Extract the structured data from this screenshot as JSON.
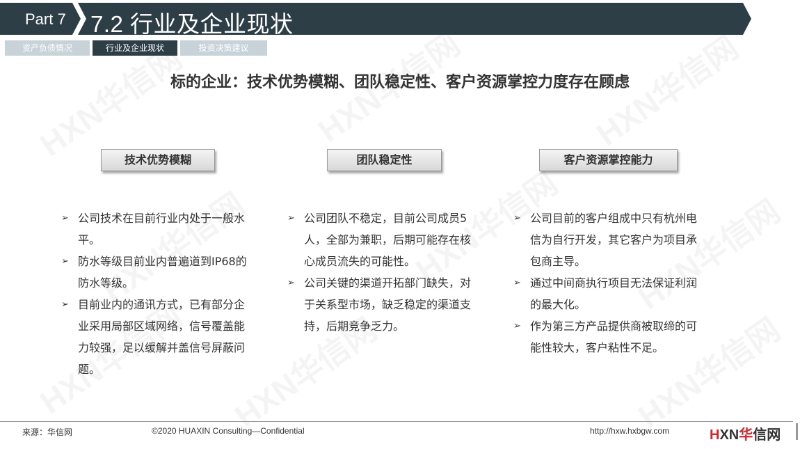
{
  "header": {
    "part_label": "Part 7",
    "title": "7.2 行业及企业现状",
    "bar_color": "#2e3e46"
  },
  "tabs": [
    {
      "label": "资产负债情况",
      "active": false
    },
    {
      "label": "行业及企业现状",
      "active": true
    },
    {
      "label": "投资决策建议",
      "active": false
    }
  ],
  "subtitle": "标的企业：技术优势模糊、团队稳定性、客户资源掌控力度存在顾虑",
  "columns": [
    {
      "heading": "技术优势模糊",
      "bullets": [
        "公司技术在目前行业内处于一般水平。",
        "防水等级目前业内普遍道到IP68的防水等级。",
        "目前业内的通讯方式，已有部分企业采用局部区域网络，信号覆盖能力较强，足以缓解并盖信号屏蔽问题。"
      ]
    },
    {
      "heading": "团队稳定性",
      "bullets": [
        "公司团队不稳定，目前公司成员5人，全部为兼职，后期可能存在核心成员流失的可能性。",
        "公司关键的渠道开拓部门缺失，对于关系型市场，缺乏稳定的渠道支持，后期竞争乏力。"
      ]
    },
    {
      "heading": "客户资源掌控能力",
      "bullets": [
        "公司目前的客户组成中只有杭州电信为自行开发，其它客户为项目承包商主导。",
        "通过中间商执行项目无法保证利润的最大化。",
        "作为第三方产品提供商被取缔的可能性较大，客户粘性不足。"
      ]
    }
  ],
  "footer": {
    "source": "来源：华信网",
    "copyright": "©2020 HUAXIN Consulting—Confidential",
    "url": "http://hxw.hxbgw.com",
    "logo_h": "H",
    "logo_xn": "XN",
    "logo_cn1": "华",
    "logo_cn2": "信网"
  },
  "watermark_text": "HXN华信网"
}
